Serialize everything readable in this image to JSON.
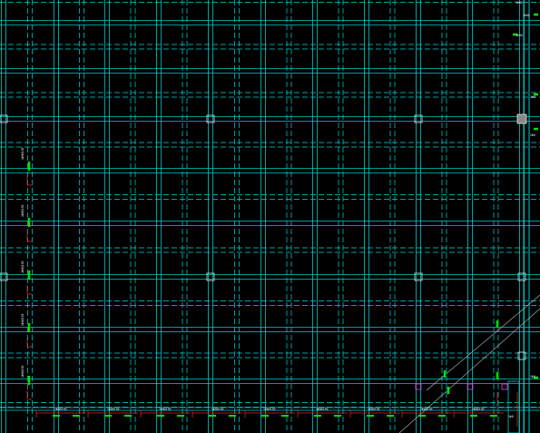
{
  "drawing": {
    "background": "#000000",
    "grid_color": "#00c8c8",
    "hidden_beam_color": "#00d8d8",
    "rebar_color": "#00e000",
    "dimension_color": "#e02020",
    "column_color": "#e0e0e0",
    "pile_color": "#e040e0"
  },
  "annotations": {
    "right_top_1": "1Φ8@",
    "right_top_2": "1Φ8@",
    "right_top_3": "1Φ8@",
    "right_mid_1": "1Φ8",
    "right_mid_2": "2Φ8",
    "right_low_1": "1Φ8",
    "left_1": "1Φ8@150",
    "left_2": "1Φ8@150",
    "left_3": "1Φ8@150",
    "left_4": "1Φ8@150",
    "left_5": "1Φ8@150",
    "bottom_1": "1Φ8@150",
    "bottom_2": "1Φ8@150",
    "bottom_3": "1Φ8@150",
    "bottom_4": "1Φ8@150",
    "bottom_5": "1Φ8@150",
    "bottom_6": "1Φ8@150",
    "bottom_7": "1Φ8@150",
    "bottom_8": "1Φ8@150",
    "bottom_9": "1Φ8@150",
    "corner_label": "1Φ8"
  }
}
